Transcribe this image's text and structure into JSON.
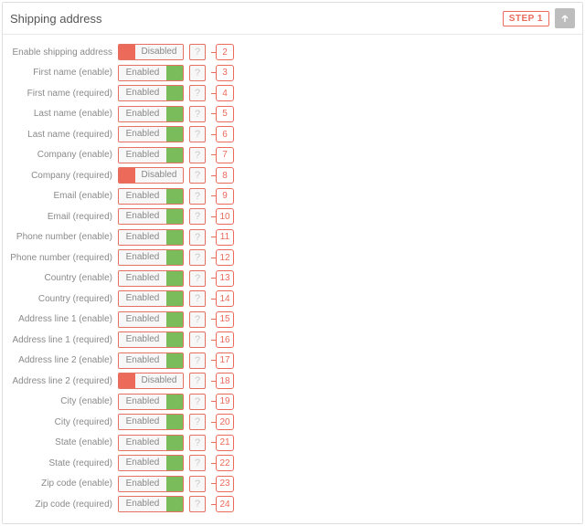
{
  "header": {
    "title": "Shipping address",
    "step_label": "STEP 1"
  },
  "help_glyph": "?",
  "states": {
    "enabled_label": "Enabled",
    "disabled_label": "Disabled"
  },
  "rows": [
    {
      "label": "Enable shipping address",
      "state": "disabled",
      "num": "2"
    },
    {
      "label": "First name (enable)",
      "state": "enabled",
      "num": "3"
    },
    {
      "label": "First name (required)",
      "state": "enabled",
      "num": "4"
    },
    {
      "label": "Last name (enable)",
      "state": "enabled",
      "num": "5"
    },
    {
      "label": "Last name (required)",
      "state": "enabled",
      "num": "6"
    },
    {
      "label": "Company (enable)",
      "state": "enabled",
      "num": "7"
    },
    {
      "label": "Company (required)",
      "state": "disabled",
      "num": "8"
    },
    {
      "label": "Email (enable)",
      "state": "enabled",
      "num": "9"
    },
    {
      "label": "Email (required)",
      "state": "enabled",
      "num": "10"
    },
    {
      "label": "Phone number (enable)",
      "state": "enabled",
      "num": "11"
    },
    {
      "label": "Phone number (required)",
      "state": "enabled",
      "num": "12"
    },
    {
      "label": "Country (enable)",
      "state": "enabled",
      "num": "13"
    },
    {
      "label": "Country (required)",
      "state": "enabled",
      "num": "14"
    },
    {
      "label": "Address line 1 (enable)",
      "state": "enabled",
      "num": "15"
    },
    {
      "label": "Address line 1 (required)",
      "state": "enabled",
      "num": "16"
    },
    {
      "label": "Address line 2 (enable)",
      "state": "enabled",
      "num": "17"
    },
    {
      "label": "Address line 2 (required)",
      "state": "disabled",
      "num": "18"
    },
    {
      "label": "City (enable)",
      "state": "enabled",
      "num": "19"
    },
    {
      "label": "City (required)",
      "state": "enabled",
      "num": "20"
    },
    {
      "label": "State (enable)",
      "state": "enabled",
      "num": "21"
    },
    {
      "label": "State (required)",
      "state": "enabled",
      "num": "22"
    },
    {
      "label": "Zip code (enable)",
      "state": "enabled",
      "num": "23"
    },
    {
      "label": "Zip code (required)",
      "state": "enabled",
      "num": "24"
    }
  ]
}
